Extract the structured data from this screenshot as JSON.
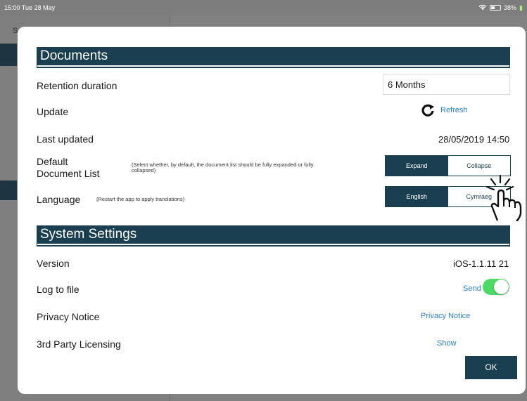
{
  "status_bar": {
    "time": "15:00",
    "date": "Tue 28 May",
    "battery": "38%"
  },
  "background": {
    "sidebar_letter": "S"
  },
  "documents": {
    "header": "Documents",
    "retention": {
      "label": "Retention duration",
      "value": "6 Months"
    },
    "update": {
      "label": "Update",
      "action": "Refresh"
    },
    "last_updated": {
      "label": "Last updated",
      "value": "28/05/2019 14:50"
    },
    "default_list": {
      "label_line1": "Default",
      "label_line2": "Document List",
      "hint": "(Select whether, by default, the document list should be fully expanded or fully collapsed)",
      "options": [
        "Expand",
        "Collapse"
      ],
      "selected": "Expand"
    },
    "language": {
      "label": "Language",
      "hint": "(Restart the app to apply translations)",
      "options": [
        "English",
        "Cymraeg"
      ],
      "selected": "English"
    }
  },
  "system": {
    "header": "System Settings",
    "version": {
      "label": "Version",
      "value": "iOS-1.1.11 21"
    },
    "log_to_file": {
      "label": "Log to file",
      "action": "Send",
      "toggle_on": true
    },
    "privacy": {
      "label": "Privacy Notice",
      "action": "Privacy Notice"
    },
    "licensing": {
      "label": "3rd Party Licensing",
      "action": "Show"
    }
  },
  "ok_label": "OK",
  "colors": {
    "navy": "#193f50",
    "link": "#2a7fd6",
    "toggle": "#4cd964"
  },
  "icons": [
    "refresh-icon",
    "pointer-hand-icon",
    "wifi-icon",
    "battery-icon"
  ]
}
